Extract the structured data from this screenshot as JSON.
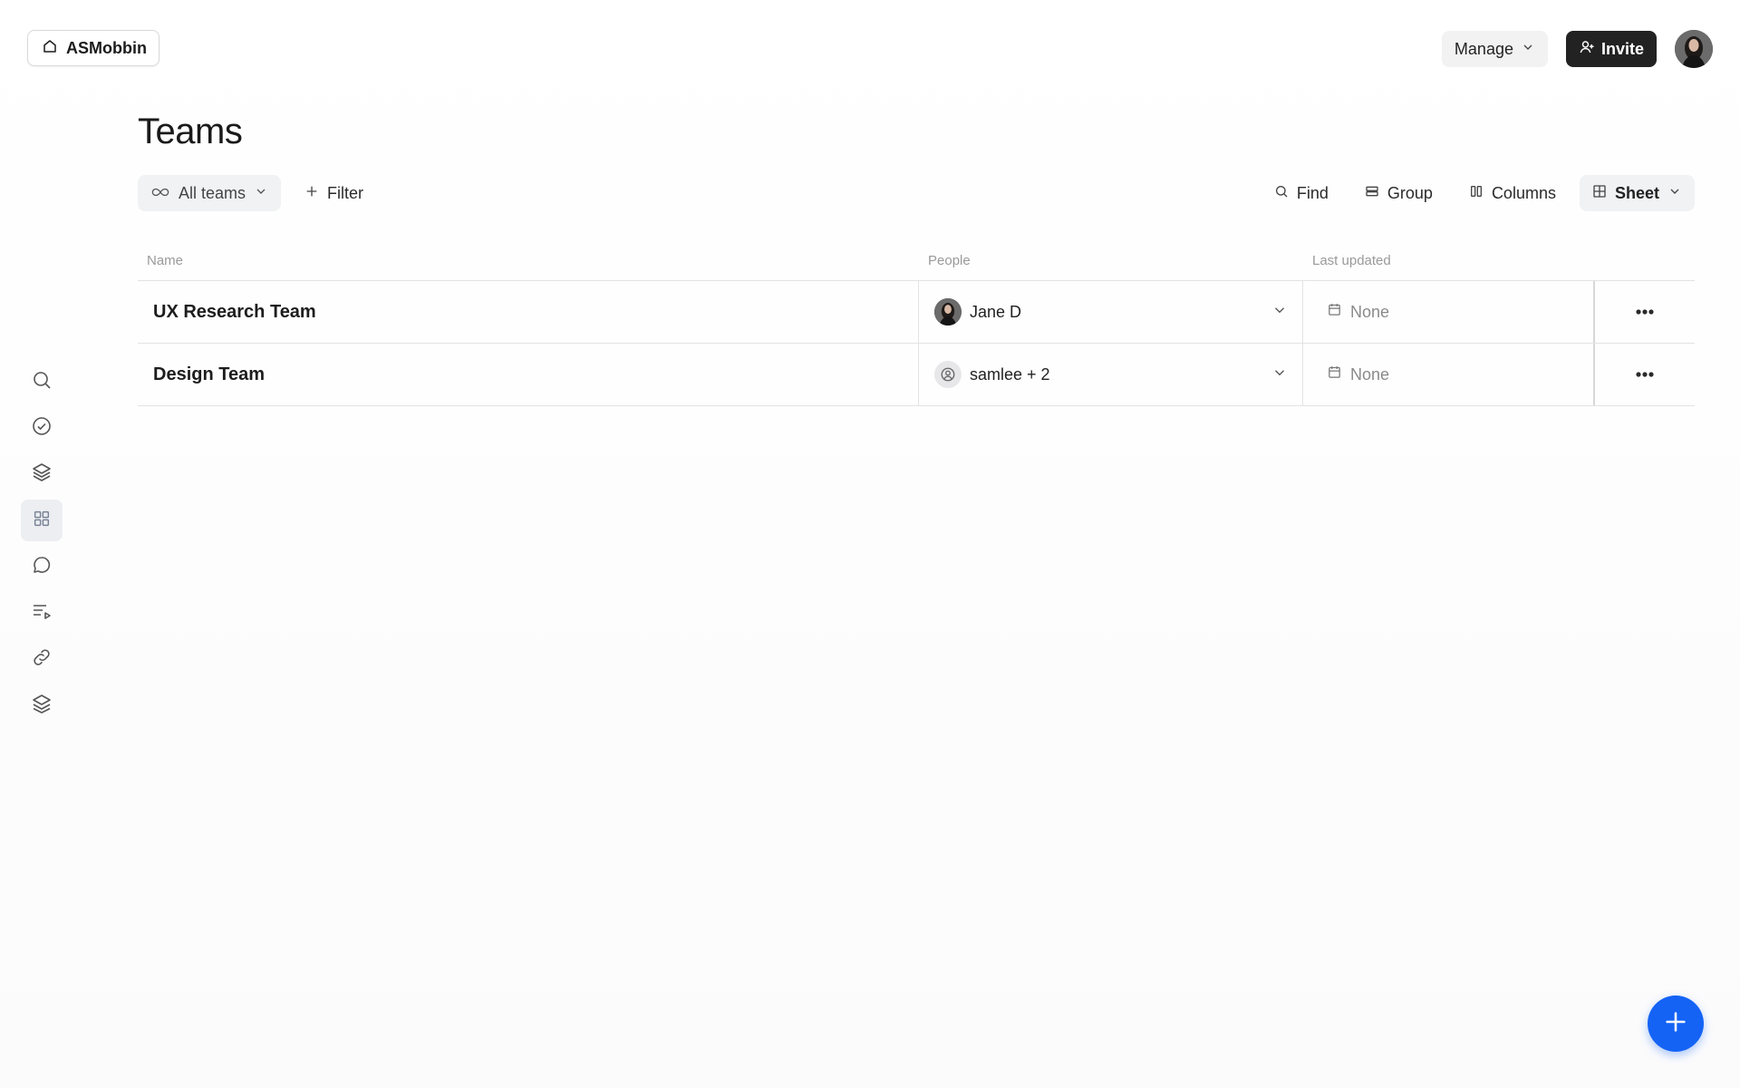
{
  "workspace": {
    "name": "ASMobbin"
  },
  "header": {
    "manage_label": "Manage",
    "invite_label": "Invite"
  },
  "sidebar": {
    "items": [
      {
        "icon": "search-icon",
        "active": false
      },
      {
        "icon": "check-circle-icon",
        "active": false
      },
      {
        "icon": "layers-icon",
        "active": false
      },
      {
        "icon": "grid-icon",
        "active": true
      },
      {
        "icon": "chat-bubble-icon",
        "active": false
      },
      {
        "icon": "playlist-icon",
        "active": false
      },
      {
        "icon": "link-icon",
        "active": false
      },
      {
        "icon": "stack-icon",
        "active": false
      }
    ]
  },
  "page": {
    "title": "Teams"
  },
  "toolbar": {
    "all_teams_label": "All teams",
    "filter_label": "Filter",
    "find_label": "Find",
    "group_label": "Group",
    "columns_label": "Columns",
    "sheet_label": "Sheet"
  },
  "table": {
    "columns": [
      "Name",
      "People",
      "Last updated"
    ],
    "rows": [
      {
        "name": "UX Research Team",
        "people": "Jane D",
        "people_icon": "avatar",
        "last_updated": "None"
      },
      {
        "name": "Design Team",
        "people": "samlee + 2",
        "people_icon": "user-circle-icon",
        "last_updated": "None"
      }
    ]
  },
  "colors": {
    "accent": "#1463f5",
    "invite_bg": "#222222"
  }
}
